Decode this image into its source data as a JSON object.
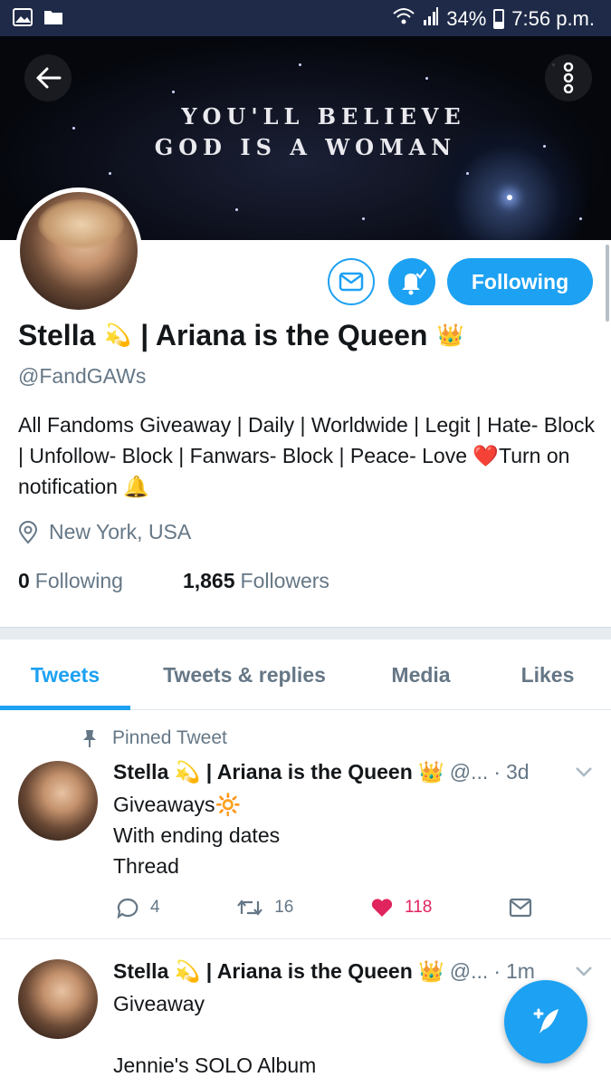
{
  "status_bar": {
    "battery": "34%",
    "time": "7:56 p.m.",
    "icons": [
      "gallery-icon",
      "folder-icon",
      "wifi-icon",
      "signal-icon",
      "battery-icon"
    ]
  },
  "header": {
    "banner_line1": "YOU'LL BELIEVE",
    "banner_line2": "GOD IS A WOMAN",
    "back_icon": "arrow-left-icon",
    "menu_icon": "more-vertical-icon"
  },
  "profile": {
    "name": "Stella",
    "name_emoji_1": "💫",
    "name_suffix": "| Ariana is the Queen",
    "name_emoji_2": "👑",
    "handle": "@FandGAWs",
    "bio": "All Fandoms Giveaway | Daily | Worldwide | Legit | Hate- Block | Unfollow- Block | Fanwars- Block | Peace- Love ❤️Turn on notification 🔔",
    "location": "New York, USA",
    "following_count": "0",
    "following_label": "Following",
    "followers_count": "1,865",
    "followers_label": "Followers",
    "follow_button_label": "Following"
  },
  "tabs": [
    {
      "label": "Tweets",
      "active": true
    },
    {
      "label": "Tweets & replies",
      "active": false
    },
    {
      "label": "Media",
      "active": false
    },
    {
      "label": "Likes",
      "active": false
    }
  ],
  "tweets": [
    {
      "pinned_label": "Pinned Tweet",
      "name": "Stella 💫 | Ariana is the Queen 👑",
      "handle": "@...",
      "time": "3d",
      "text": "Giveaways🔆\nWith ending dates\nThread",
      "replies": "4",
      "retweets": "16",
      "likes": "118"
    },
    {
      "name": "Stella 💫 | Ariana is the Queen 👑",
      "handle": "@...",
      "time": "1m",
      "text": "Giveaway\n\nJennie's SOLO Album"
    }
  ],
  "colors": {
    "accent": "#1da1f2",
    "like": "#e0245e",
    "muted": "#657786",
    "status_bar": "#1e2a48"
  }
}
